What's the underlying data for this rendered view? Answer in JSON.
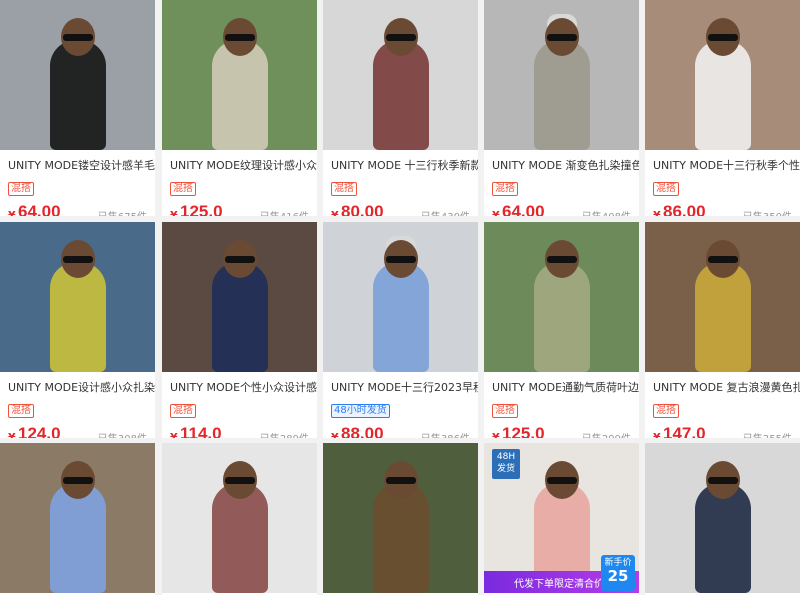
{
  "products": [
    {
      "title": "UNITY MODE镂空设计感羊毛...",
      "badge": "混搭",
      "badge_style": "red",
      "price": "64.00",
      "sold": "已售675件",
      "bg": "#9aa0a6",
      "outfit": "#151515"
    },
    {
      "title": "UNITY MODE纹理设计感小众...",
      "badge": "混搭",
      "badge_style": "red",
      "price": "125.0",
      "sold": "已售416件",
      "bg": "#6f8f5b",
      "outfit": "#cfcab6"
    },
    {
      "title": "UNITY MODE 十三行秋季新款...",
      "badge": "混搭",
      "badge_style": "red",
      "price": "80.00",
      "sold": "已售430件",
      "bg": "#d7d7d7",
      "outfit": "#7a3b3b"
    },
    {
      "title": "UNITY MODE 渐变色扎染撞色...",
      "badge": "混搭",
      "badge_style": "red",
      "price": "64.00",
      "sold": "已售408件",
      "bg": "#b7b7b7",
      "outfit": "#9c9a8d"
    },
    {
      "title": "UNITY MODE十三行秋季个性...",
      "badge": "混搭",
      "badge_style": "red",
      "price": "86.00",
      "sold": "已售350件",
      "bg": "#a88c7a",
      "outfit": "#eeeeee"
    },
    {
      "title": "UNITY MODE设计感小众扎染...",
      "badge": "混搭",
      "badge_style": "red",
      "price": "124.0",
      "sold": "已售308件",
      "bg": "#4a6a8a",
      "outfit": "#c9c13a"
    },
    {
      "title": "UNITY MODE个性小众设计感...",
      "badge": "混搭",
      "badge_style": "red",
      "price": "114.0",
      "sold": "已售289件",
      "bg": "#5a4a42",
      "outfit": "#1f2e5a"
    },
    {
      "title": "UNITY MODE十三行2023早秋...",
      "badge": "48小时发货",
      "badge_style": "blue",
      "price": "88.00",
      "sold": "已售386件",
      "bg": "#cfd3d8",
      "outfit": "#7aa0d8"
    },
    {
      "title": "UNITY MODE通勤气质荷叶边...",
      "badge": "混搭",
      "badge_style": "red",
      "price": "125.0",
      "sold": "已售299件",
      "bg": "#6d8a5a",
      "outfit": "#a3a882"
    },
    {
      "title": "UNITY MODE 复古浪漫黄色扎...",
      "badge": "混搭",
      "badge_style": "red",
      "price": "147.0",
      "sold": "已售255件",
      "bg": "#7a6048",
      "outfit": "#c9a93a"
    },
    {
      "title": "",
      "badge": "",
      "badge_style": "",
      "price": "",
      "sold": "",
      "bg": "#8a7a66",
      "outfit": "#7ea2e0"
    },
    {
      "title": "",
      "badge": "",
      "badge_style": "",
      "price": "",
      "sold": "",
      "bg": "#e6e6e6",
      "outfit": "#8a4a4a"
    },
    {
      "title": "",
      "badge": "",
      "badge_style": "",
      "price": "",
      "sold": "",
      "bg": "#4f5f3e",
      "outfit": "#6a4e2e"
    },
    {
      "title": "",
      "badge": "",
      "badge_style": "",
      "price": "",
      "sold": "",
      "bg": "#e8e4df",
      "outfit": "#e8a6a0"
    },
    {
      "title": "",
      "badge": "",
      "badge_style": "",
      "price": "",
      "sold": "",
      "bg": "#d8d8d8",
      "outfit": "#1f2a44"
    }
  ],
  "tag48": {
    "line1": "48H",
    "line2": "发货"
  },
  "promo": {
    "text": "代发下单限定清合价￥",
    "box_label": "新手价",
    "box_value": "25"
  }
}
